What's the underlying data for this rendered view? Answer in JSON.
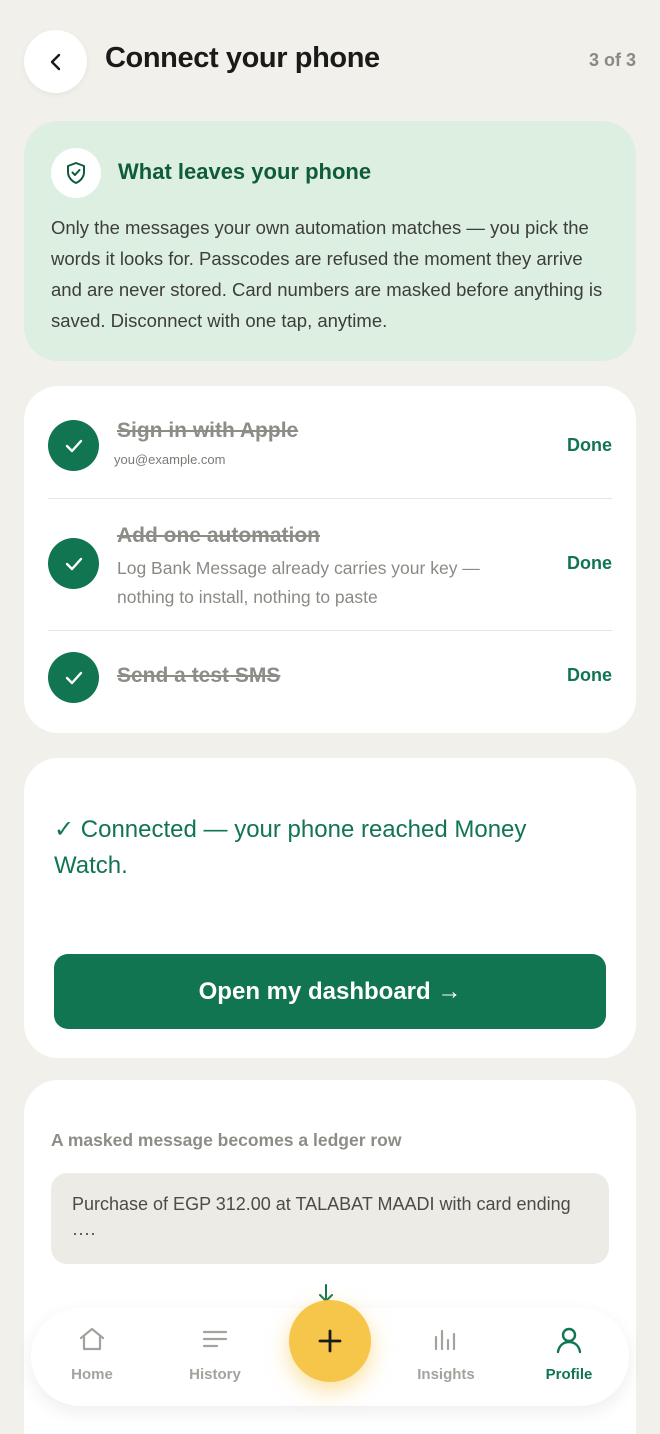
{
  "header": {
    "title": "Connect your phone",
    "step": "3 of 3"
  },
  "privacy": {
    "title": "What leaves your phone",
    "body": "Only the messages your own automation matches — you pick the words it looks for. Passcodes are refused the moment they arrive and are never stored. Card numbers are masked before anything is saved. Disconnect with one tap, anytime."
  },
  "steps": [
    {
      "title": "Sign in with Apple",
      "subtitle": "you@example.com",
      "status": "Done"
    },
    {
      "title": "Add one automation",
      "subtitle": "Log Bank Message already carries your key — nothing to install, nothing to paste",
      "status": "Done"
    },
    {
      "title": "Send a test SMS",
      "subtitle": "",
      "status": "Done"
    }
  ],
  "connection": {
    "message": "✓ Connected — your phone reached Money Watch.",
    "button": "Open my dashboard →"
  },
  "ledger": {
    "title": "A masked message becomes a ledger row",
    "message": "Purchase of EGP 312.00 at TALABAT MAADI with card ending ····"
  },
  "nav": {
    "home": "Home",
    "history": "History",
    "insights": "Insights",
    "profile": "Profile",
    "active": "profile"
  },
  "colors": {
    "accent": "#127552",
    "fab": "#f6c64a",
    "background": "#f1f0eb",
    "privacy_card": "#dcefe1"
  }
}
